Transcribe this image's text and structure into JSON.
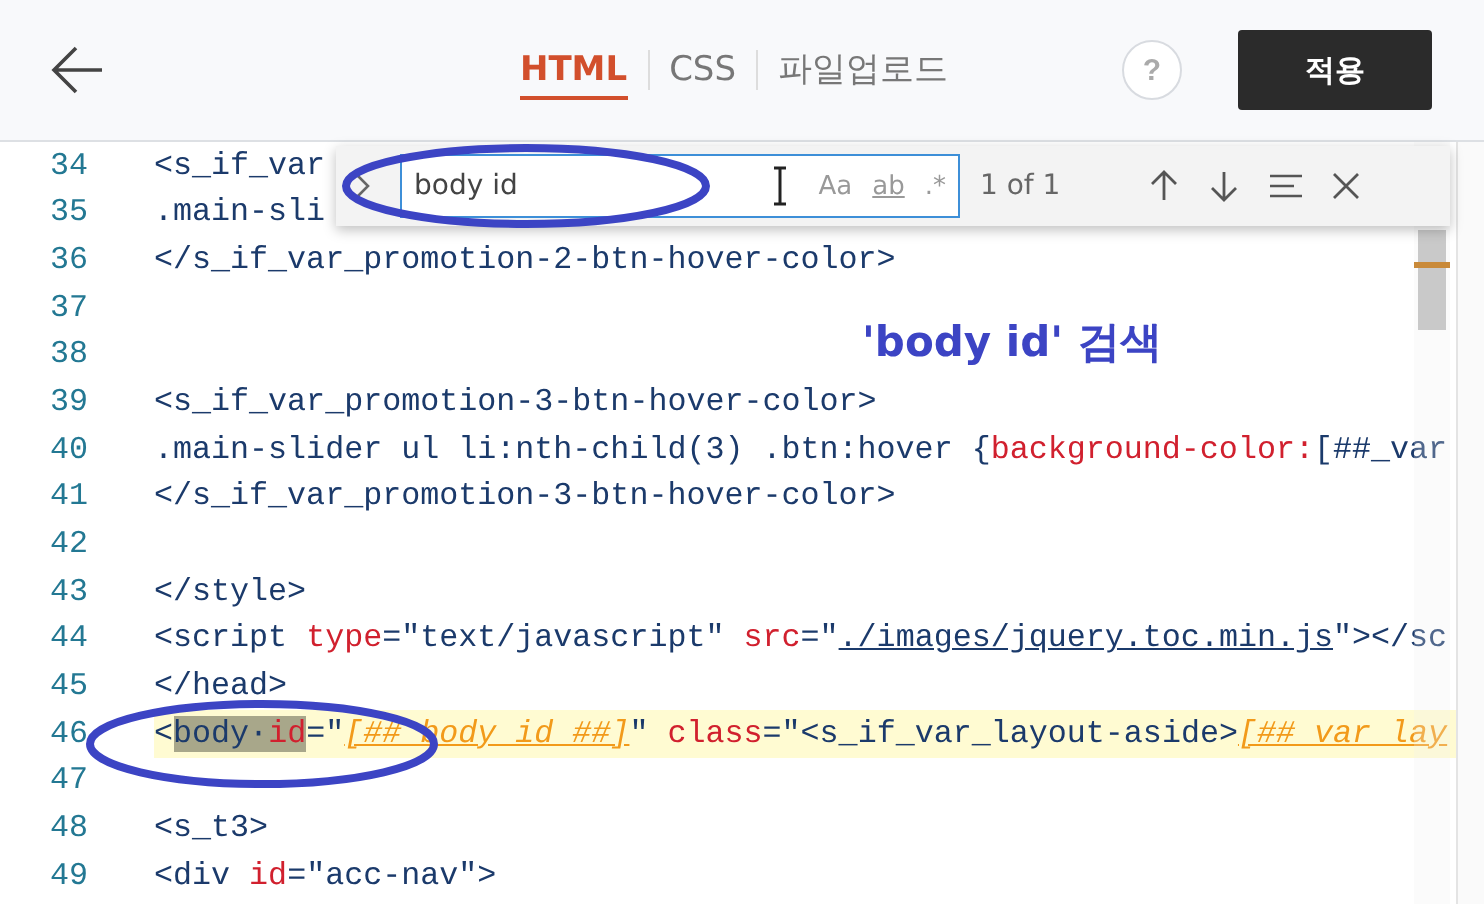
{
  "header": {
    "tabs": [
      {
        "label": "HTML",
        "selected": true
      },
      {
        "label": "CSS",
        "selected": false
      },
      {
        "label": "파일업로드",
        "selected": false
      }
    ],
    "help": "?",
    "apply_button": "적용"
  },
  "editor": {
    "lines": [
      {
        "number": "34",
        "current": false,
        "segments": [
          {
            "kind": "text",
            "text": "<s_if_var"
          }
        ]
      },
      {
        "number": "35",
        "current": false,
        "segments": [
          {
            "kind": "text",
            "text": ".main-sli"
          }
        ]
      },
      {
        "number": "36",
        "current": false,
        "segments": [
          {
            "kind": "text",
            "text": "</s_if_var_promotion-2-btn-hover-color>"
          }
        ]
      },
      {
        "number": "37",
        "current": false
      },
      {
        "number": "38",
        "current": false
      },
      {
        "number": "39",
        "current": false,
        "segments": [
          {
            "kind": "text",
            "text": "<s_if_var_promotion-3-btn-hover-color>"
          }
        ]
      },
      {
        "number": "40",
        "current": false,
        "segments": [
          {
            "kind": "text",
            "text": ".main-slider ul li:nth-child(3) .btn:hover {"
          },
          {
            "kind": "attr",
            "text": "background-color:"
          },
          {
            "kind": "text",
            "text": "[##_var"
          }
        ]
      },
      {
        "number": "41",
        "current": false,
        "segments": [
          {
            "kind": "text",
            "text": "</s_if_var_promotion-3-btn-hover-color>"
          }
        ]
      },
      {
        "number": "42",
        "current": false
      },
      {
        "number": "43",
        "current": false,
        "segments": [
          {
            "kind": "text",
            "text": "</style>"
          }
        ]
      },
      {
        "number": "44",
        "current": false,
        "segments": [
          {
            "kind": "text",
            "text": "<script "
          },
          {
            "kind": "attr",
            "text": "type"
          },
          {
            "kind": "text",
            "text": "=\"text/javascript\" "
          },
          {
            "kind": "attr",
            "text": "src"
          },
          {
            "kind": "text",
            "text": "=\""
          },
          {
            "kind": "link",
            "text": "./images/jquery.toc.min.js"
          },
          {
            "kind": "text",
            "text": "\"></sc"
          }
        ]
      },
      {
        "number": "45",
        "current": false,
        "segments": [
          {
            "kind": "text",
            "text": "</head>"
          }
        ]
      },
      {
        "number": "46",
        "current": true,
        "segments": [
          {
            "kind": "text",
            "text": "<"
          },
          {
            "kind": "match",
            "text": "body"
          },
          {
            "kind": "match",
            "text": "·"
          },
          {
            "kind": "match-attr",
            "text": "id"
          },
          {
            "kind": "text",
            "text": "=\""
          },
          {
            "kind": "template",
            "text": "[##_body_id_##]"
          },
          {
            "kind": "text",
            "text": "\" "
          },
          {
            "kind": "attr",
            "text": "class"
          },
          {
            "kind": "text",
            "text": "=\"<s_if_var_layout-aside>"
          },
          {
            "kind": "template",
            "text": "[##_var_lay"
          }
        ]
      },
      {
        "number": "47",
        "current": false
      },
      {
        "number": "48",
        "current": false,
        "segments": [
          {
            "kind": "text",
            "text": "<s_t3>"
          }
        ]
      },
      {
        "number": "49",
        "current": false,
        "segments": [
          {
            "kind": "text",
            "text": "<div "
          },
          {
            "kind": "attr",
            "text": "id"
          },
          {
            "kind": "text",
            "text": "=\"acc-nav\">"
          }
        ]
      }
    ]
  },
  "find_widget": {
    "value": "body id",
    "options": [
      "Aa",
      "ab",
      ".*"
    ],
    "result": "1 of 1"
  },
  "annotation": {
    "label": "'body id' 검색"
  }
}
